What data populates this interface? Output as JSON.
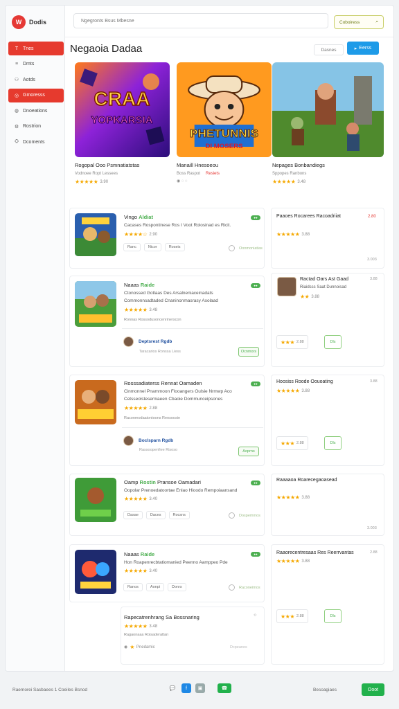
{
  "brand": {
    "name": "Dodis",
    "logo": "W"
  },
  "sidebar": {
    "items": [
      {
        "label": "Tnes",
        "icon": "T",
        "active": true
      },
      {
        "label": "Dmts",
        "icon": "≡",
        "active": false
      },
      {
        "label": "Aotds",
        "icon": "⚇",
        "active": false
      },
      {
        "label": "Gmoresss",
        "icon": "◎",
        "active": true
      },
      {
        "label": "Dnoeations",
        "icon": "◍",
        "active": false
      },
      {
        "label": "Rostrion",
        "icon": "⚙",
        "active": false
      },
      {
        "label": "Dcoments",
        "icon": "⛭",
        "active": false
      }
    ]
  },
  "search": {
    "placeholder": "Ngegronts Bsus Mbesne"
  },
  "search_button": {
    "label": "Coboiress"
  },
  "page_title": "Negaoia Dadaa",
  "sort_label": "Dasnes",
  "primary_button": {
    "label": "Eerss"
  },
  "featured": [
    {
      "title": "Rogopal Ooo Psmnatiatstas",
      "sub_left": "Vodnoee Ropt Lessees",
      "rating": "3.90",
      "art": "art1",
      "art_text_1": "CRAA",
      "art_text_2": "YOPKARSIA"
    },
    {
      "title": "Manaill Hnesoeou",
      "sub_left": "Boss Raspot",
      "sub_right": "Resiets",
      "rating": "",
      "art": "art2",
      "art_text_1": "PHETUNNIS",
      "art_text_2": "DI MOSERS"
    },
    {
      "title": "Nepages Bonbandiegs",
      "sub_left": "Sppopes Ranbons",
      "rating": "3.48",
      "art": "art3"
    }
  ],
  "list": [
    {
      "title": "Vingo",
      "tag": "Aldiat",
      "desc": "Cacases Rospontinese Ros I Voot Rolosinad es Ricit.",
      "rating": "2.90",
      "tags": [
        "Ranc",
        "Nicor",
        "Roseis"
      ],
      "ghost": "Oonmoniatias"
    },
    {
      "title": "Naaas",
      "tag": "Raide",
      "desc1": "Ctonossed Gotlaas Des Arsalneniaceinadats",
      "desc2": "Commonnsadtaded Cnaninonmasrasy Asolaad",
      "rating": "3.48",
      "meta": "Ronnas Rossodusoncenrinerscon",
      "author": "Deptsrest Rgdb",
      "author_meta": "Taracarios Ronssa Liess",
      "btn": "Ocnmors"
    },
    {
      "title": "Rosssadiaterss Rennat Oamaden",
      "desc1": "Cinmonnel Pnammoon Flooangers Oulsie Nrmwp Aco",
      "desc2": "Cetsseolsteserniaeen Cbaoie Dommunceipsones",
      "rating": "2.88",
      "meta": "Raconmodaaiontoons Rensoosie",
      "author": "Boclsparn Rgdb",
      "author_meta": "Rassoopenfiee Risoso",
      "btn": "Aoprns"
    },
    {
      "title": "Oamp",
      "tag": "Rostin",
      "title_tail": "Pransoe Oamadari",
      "desc": "Oopolar Prenoedatoortae Enlao Hioodo Rempoiaansand",
      "rating": "3.40",
      "tags": [
        "Dasae",
        "Daces",
        "Rocsns"
      ],
      "ghost": "Dospemmos"
    },
    {
      "title": "Naaas",
      "tag": "Raide",
      "desc": "Hon Roapenrecbtatiomanied Peenno Aamppeo Pde",
      "rating": "3.40",
      "tags": [
        "Ranos",
        "Aonpi",
        "Donrs"
      ],
      "ghost": "Raconeimos"
    },
    {
      "title": "Rapecatrenhrang Sa",
      "title_tail": "Bossnaring",
      "desc": "Ragaonaaa Roisaderattan",
      "rating": "3.48",
      "meta": "Pnedamic",
      "ghost": "Dcpeanes"
    }
  ],
  "right": [
    {
      "title": "Paaoes Rocarees Racoadriiat",
      "badge": "2.80",
      "rating": "3.88",
      "num": "3.003"
    },
    {
      "title": "Ractad Oars Ast Gaad",
      "sub": "Riaidsss Saat Dunnoisad",
      "rating": "3.88",
      "num": "3.88",
      "btn_a": "2.88",
      "btn_b": "Dls"
    },
    {
      "title": "Hoosiss Roode Oouoating",
      "rating": "3.88",
      "num": "3.88",
      "btn_a": "2.88",
      "btn_b": "Dls"
    },
    {
      "title": "Raaaaoa Roarecegaoasead",
      "rating": "3.88",
      "num": "3.003"
    },
    {
      "title": "Raaorecentresaas Res Reerrvantas",
      "rating": "3.88",
      "num": "2.88",
      "btn_a": "2.88",
      "btn_b": "Dls"
    }
  ],
  "footer": {
    "left": "Raemorei  Sasbaees 1  Coeiles Bsnod",
    "right": "Besoagiaes",
    "button": "Ooot"
  }
}
